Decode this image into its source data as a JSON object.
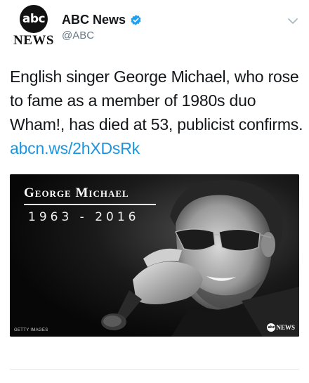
{
  "account": {
    "logo_text": "abc",
    "logo_subtext": "NEWS",
    "display_name": "ABC News",
    "handle": "@ABC",
    "verified_color": "#1da1f2"
  },
  "tweet": {
    "text": "English singer George Michael, who rose to fame as a member of 1980s duo Wham!, has died at 53, publicist confirms.",
    "link": "abcn.ws/2hXDsRk",
    "link_color": "#1b95e0"
  },
  "media": {
    "card_name": "George Michael",
    "card_years": "1963 - 2016",
    "credit": "GETTY IMAGES",
    "watermark_logo": "abc",
    "watermark_text": "NEWS"
  },
  "icons": {
    "verified": "verified-badge-icon",
    "more": "chevron-down-icon"
  }
}
